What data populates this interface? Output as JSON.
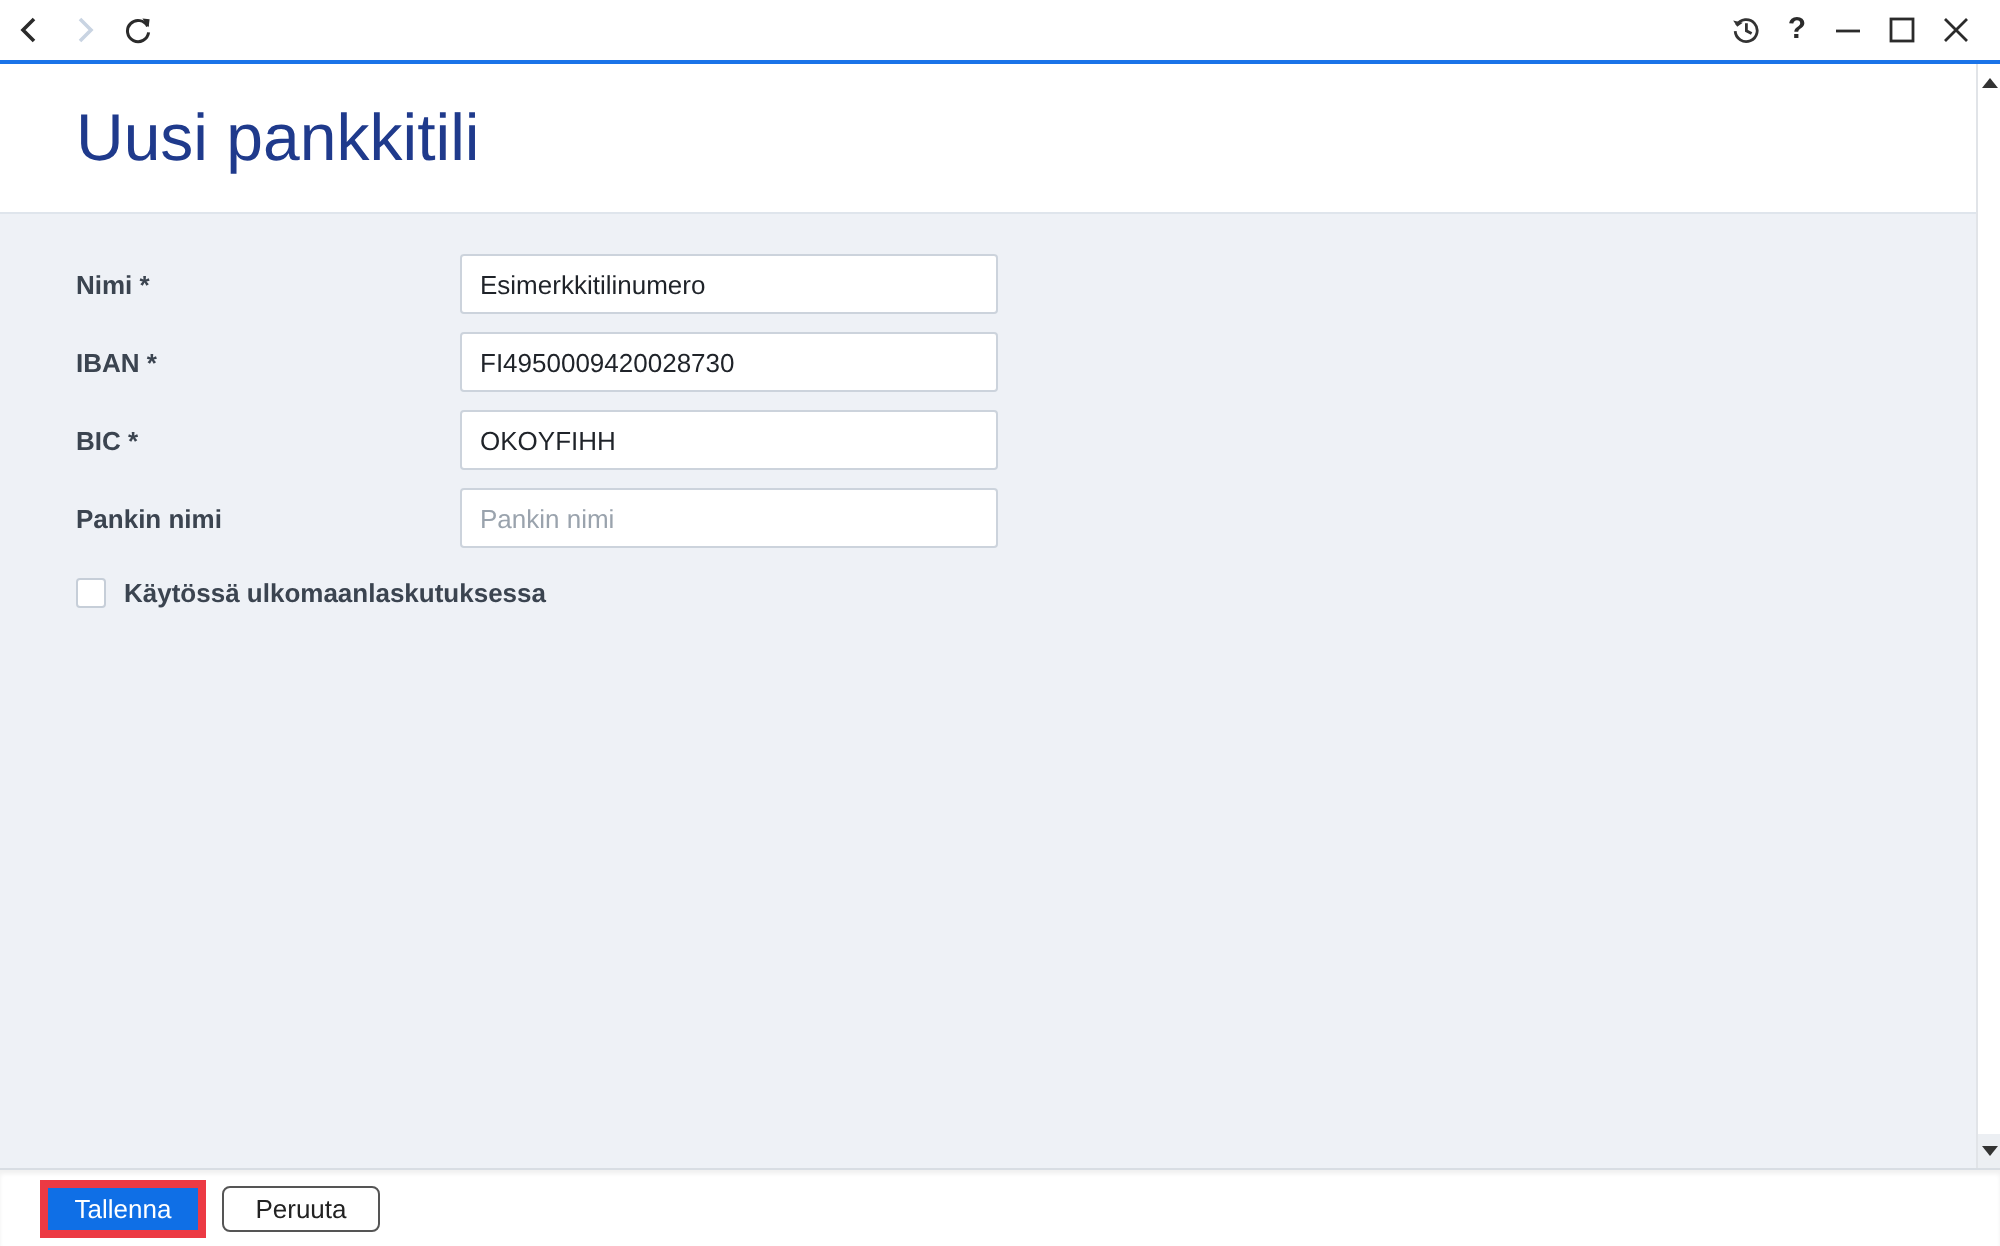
{
  "toolbar": {
    "nav": [
      {
        "kind": "back",
        "disabled": false
      },
      {
        "kind": "forward",
        "disabled": true
      },
      {
        "kind": "reload",
        "disabled": false
      }
    ],
    "actions": [
      {
        "kind": "history"
      },
      {
        "kind": "help",
        "label": "?"
      }
    ],
    "window_controls": [
      {
        "kind": "minimize"
      },
      {
        "kind": "maximize"
      },
      {
        "kind": "close"
      }
    ]
  },
  "page": {
    "title": "Uusi pankkitili"
  },
  "form": {
    "fields": [
      {
        "label": "Nimi *",
        "value": "Esimerkkitilinumero"
      },
      {
        "label": "IBAN *",
        "value": "FI4950009420028730"
      },
      {
        "label": "BIC *",
        "value": "OKOYFIHH"
      },
      {
        "label": "Pankin nimi",
        "placeholder": "Pankin nimi"
      }
    ],
    "checkbox": {
      "label": "Käytössä ulkomaanlaskutuksessa",
      "checked": false
    }
  },
  "footer": {
    "buttons": [
      {
        "label": "Tallenna",
        "kind": "primary",
        "highlighted": true
      },
      {
        "label": "Peruuta",
        "kind": "secondary",
        "highlighted": false
      }
    ]
  }
}
